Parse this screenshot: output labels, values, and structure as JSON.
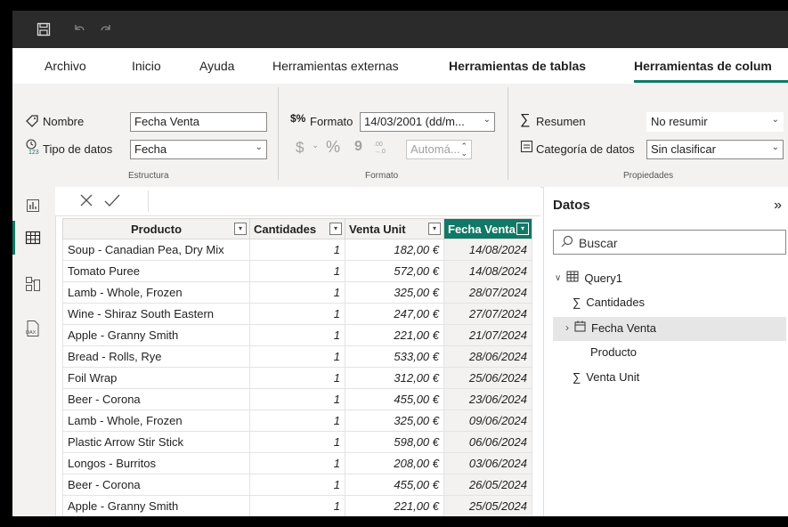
{
  "ribbon_tabs": [
    "Archivo",
    "Inicio",
    "Ayuda",
    "Herramientas externas",
    "Herramientas de tablas",
    "Herramientas de colum"
  ],
  "structure": {
    "name_label": "Nombre",
    "name_value": "Fecha Venta",
    "datatype_label": "Tipo de datos",
    "datatype_value": "Fecha",
    "group_label": "Estructura"
  },
  "format": {
    "format_label": "Formato",
    "format_value": "14/03/2001 (dd/m...",
    "currency_symbol": "$",
    "percent_symbol": "%",
    "comma_symbol": "9",
    "auto_value": "Automá...",
    "group_label": "Formato"
  },
  "properties": {
    "summary_label": "Resumen",
    "summary_value": "No resumir",
    "category_label": "Categoría de datos",
    "category_value": "Sin clasificar",
    "group_label": "Propiedades"
  },
  "table": {
    "columns": [
      "Producto",
      "Cantidades",
      "Venta Unit",
      "Fecha Venta"
    ],
    "rows": [
      [
        "Soup - Canadian Pea, Dry Mix",
        "1",
        "182,00 €",
        "14/08/2024"
      ],
      [
        "Tomato Puree",
        "1",
        "572,00 €",
        "14/08/2024"
      ],
      [
        "Lamb - Whole, Frozen",
        "1",
        "325,00 €",
        "28/07/2024"
      ],
      [
        "Wine - Shiraz South Eastern",
        "1",
        "247,00 €",
        "27/07/2024"
      ],
      [
        "Apple - Granny Smith",
        "1",
        "221,00 €",
        "21/07/2024"
      ],
      [
        "Bread - Rolls, Rye",
        "1",
        "533,00 €",
        "28/06/2024"
      ],
      [
        "Foil Wrap",
        "1",
        "312,00 €",
        "25/06/2024"
      ],
      [
        "Beer - Corona",
        "1",
        "455,00 €",
        "23/06/2024"
      ],
      [
        "Lamb - Whole, Frozen",
        "1",
        "325,00 €",
        "09/06/2024"
      ],
      [
        "Plastic Arrow Stir Stick",
        "1",
        "598,00 €",
        "06/06/2024"
      ],
      [
        "Longos - Burritos",
        "1",
        "208,00 €",
        "03/06/2024"
      ],
      [
        "Beer - Corona",
        "1",
        "455,00 €",
        "26/05/2024"
      ],
      [
        "Apple - Granny Smith",
        "1",
        "221,00 €",
        "25/05/2024"
      ]
    ]
  },
  "data_pane": {
    "title": "Datos",
    "search_placeholder": "Buscar",
    "table_name": "Query1",
    "fields": [
      "Cantidades",
      "Fecha Venta",
      "Producto",
      "Venta Unit"
    ]
  },
  "colors": {
    "accent": "#117865",
    "titlebar": "#2b2b2b"
  }
}
